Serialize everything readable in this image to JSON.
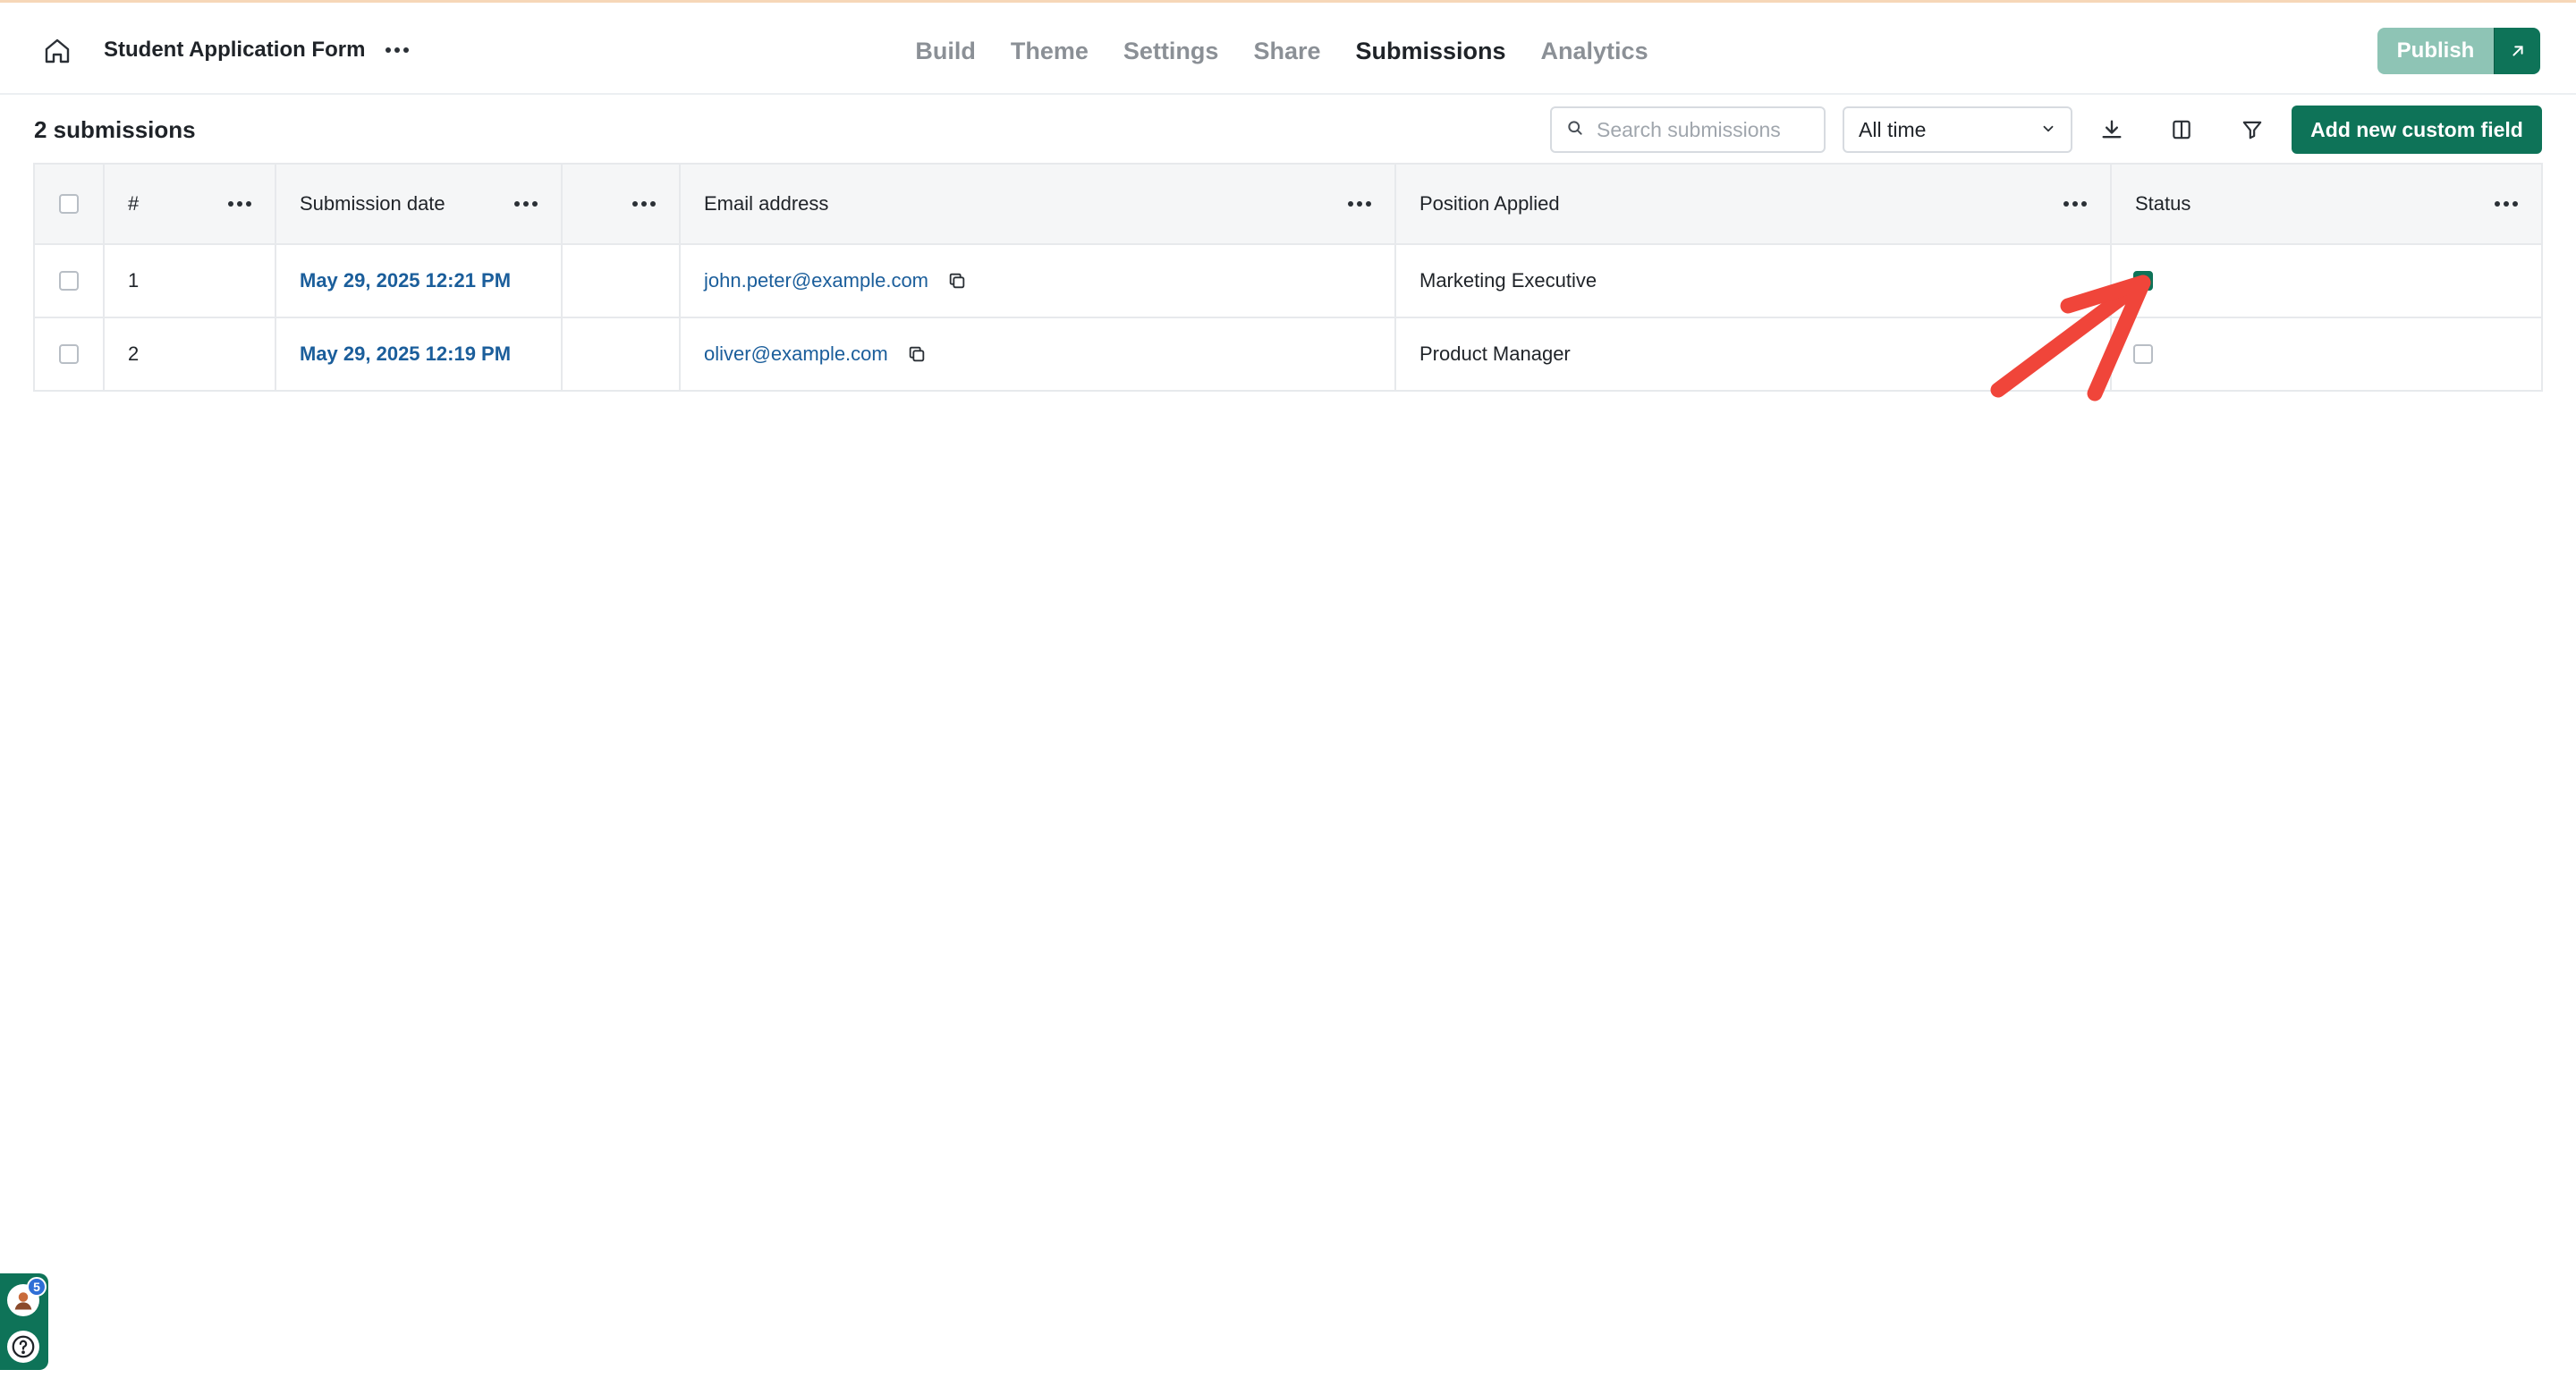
{
  "header": {
    "form_title": "Student Application Form",
    "tabs": [
      {
        "label": "Build",
        "active": false
      },
      {
        "label": "Theme",
        "active": false
      },
      {
        "label": "Settings",
        "active": false
      },
      {
        "label": "Share",
        "active": false
      },
      {
        "label": "Submissions",
        "active": true
      },
      {
        "label": "Analytics",
        "active": false
      }
    ],
    "publish_label": "Publish"
  },
  "toolbar": {
    "count_label": "2 submissions",
    "search_placeholder": "Search submissions",
    "time_filter": "All time",
    "add_field_label": "Add new custom field"
  },
  "table": {
    "columns": [
      "#",
      "Submission date",
      "",
      "Email address",
      "Position Applied",
      "Status"
    ],
    "rows": [
      {
        "num": "1",
        "date": "May 29, 2025 12:21 PM",
        "email": "john.peter@example.com",
        "position": "Marketing Executive",
        "status_checked": true
      },
      {
        "num": "2",
        "date": "May 29, 2025 12:19 PM",
        "email": "oliver@example.com",
        "position": "Product Manager",
        "status_checked": false
      }
    ]
  },
  "widget": {
    "badge_count": "5"
  },
  "colors": {
    "brand": "#0e7358",
    "publish_disabled": "#8ec4b5",
    "link": "#1b5e9b",
    "annotation_arrow": "#f0453a"
  },
  "icons": {
    "home": "home-icon",
    "more": "more-horizontal-icon",
    "external": "arrow-up-right-icon",
    "search": "search-icon",
    "chevron": "chevron-down-icon",
    "download": "download-icon",
    "columns": "columns-icon",
    "filter": "filter-icon",
    "copy": "copy-icon",
    "help": "help-icon"
  }
}
